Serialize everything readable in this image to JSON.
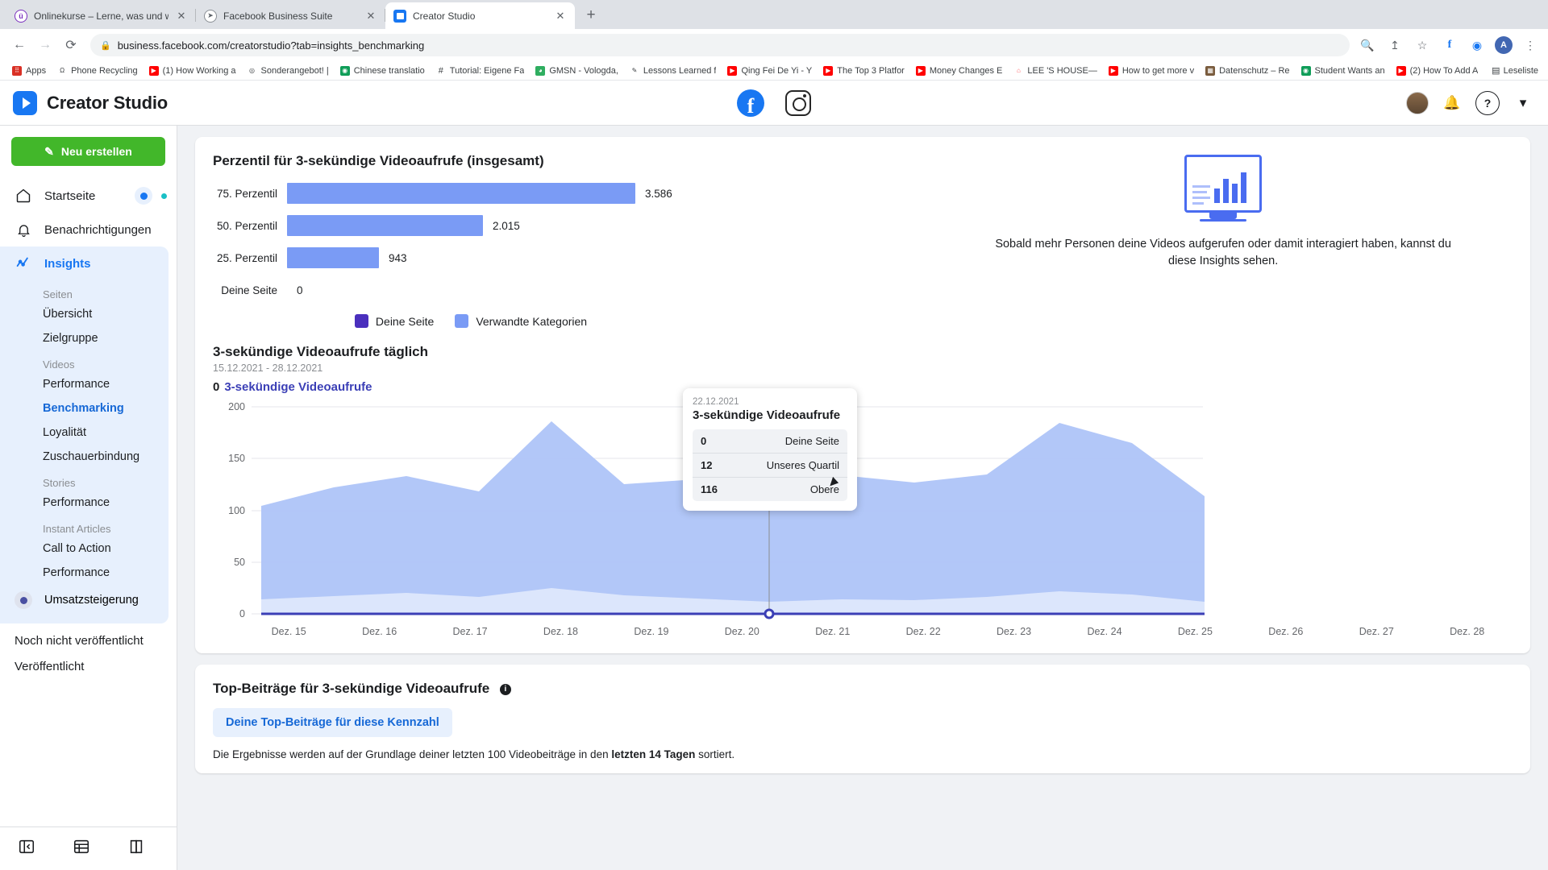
{
  "browser": {
    "tabs": [
      {
        "title": "Onlinekurse – Lerne, was und w",
        "icon": "udemy-icon",
        "active": false
      },
      {
        "title": "Facebook Business Suite",
        "icon": "compass-icon",
        "active": false
      },
      {
        "title": "Creator Studio",
        "icon": "creator-studio-icon",
        "active": true
      }
    ],
    "new_tab_label": "+",
    "close_label": "✕",
    "nav": {
      "back": "←",
      "forward": "→",
      "reload": "⟳"
    },
    "url": "business.facebook.com/creatorstudio?tab=insights_benchmarking",
    "lock_icon": "lock-icon",
    "toolbar_icons": [
      "zoom-icon",
      "share-icon",
      "star-icon",
      "facebook-ext-icon",
      "extension-icon",
      "menu-icon"
    ],
    "bookmarks": [
      {
        "label": "Apps",
        "icon": "apps-grid-icon",
        "color": "#d93025"
      },
      {
        "label": "Phone Recycling",
        "icon": "omega-icon",
        "color": "#5f6368"
      },
      {
        "label": "(1) How Working a",
        "icon": "youtube-icon",
        "color": "#ff0000"
      },
      {
        "label": "Sonderangebot! |",
        "icon": "circle-icon",
        "color": "#5f6368"
      },
      {
        "label": "Chinese translatio",
        "icon": "green-circle-icon",
        "color": "#0f9d58"
      },
      {
        "label": "Tutorial: Eigene Fa",
        "icon": "hash-icon",
        "color": "#3c4043"
      },
      {
        "label": "GMSN - Vologda,",
        "icon": "green-app-icon",
        "color": "#2fae60"
      },
      {
        "label": "Lessons Learned f",
        "icon": "pen-icon",
        "color": "#5f6368"
      },
      {
        "label": "Qing Fei De Yi - Y",
        "icon": "youtube-icon",
        "color": "#ff0000"
      },
      {
        "label": "The Top 3 Platfor",
        "icon": "youtube-icon",
        "color": "#ff0000"
      },
      {
        "label": "Money Changes E",
        "icon": "youtube-icon",
        "color": "#ff0000"
      },
      {
        "label": "LEE 'S HOUSE—",
        "icon": "airbnb-icon",
        "color": "#ff5a5f"
      },
      {
        "label": "How to get more v",
        "icon": "youtube-icon",
        "color": "#ff0000"
      },
      {
        "label": "Datenschutz – Re",
        "icon": "image-icon",
        "color": "#7a5c3e"
      },
      {
        "label": "Student Wants an",
        "icon": "green-circle-icon",
        "color": "#0f9d58"
      },
      {
        "label": "(2) How To Add A",
        "icon": "youtube-icon",
        "color": "#ff0000"
      }
    ],
    "reading_list": "Leseliste"
  },
  "appbar": {
    "brand": "Creator Studio",
    "brand_icon": "creator-studio-logo",
    "platform_tabs": [
      {
        "name": "facebook-tab",
        "glyph": "f"
      },
      {
        "name": "instagram-tab",
        "glyph": ""
      }
    ],
    "right_icons": [
      "avatar",
      "bell-icon",
      "help-icon",
      "chevron-down-icon"
    ],
    "help_glyph": "?",
    "chevron_glyph": "▾"
  },
  "sidebar": {
    "create_button": "Neu erstellen",
    "create_icon": "compose-icon",
    "items": [
      {
        "label": "Startseite",
        "icon": "home-icon",
        "badge": true
      },
      {
        "label": "Benachrichtigungen",
        "icon": "bell-icon",
        "badge": false
      }
    ],
    "insights": {
      "label": "Insights",
      "icon": "insights-chart-icon",
      "groups": [
        {
          "title": "Seiten",
          "links": [
            {
              "label": "Übersicht",
              "active": false
            },
            {
              "label": "Zielgruppe",
              "active": false
            }
          ]
        },
        {
          "title": "Videos",
          "links": [
            {
              "label": "Performance",
              "active": false
            },
            {
              "label": "Benchmarking",
              "active": true
            },
            {
              "label": "Loyalität",
              "active": false
            },
            {
              "label": "Zuschauerbindung",
              "active": false
            }
          ]
        },
        {
          "title": "Stories",
          "links": [
            {
              "label": "Performance",
              "active": false
            }
          ]
        },
        {
          "title": "Instant Articles",
          "links": [
            {
              "label": "Call to Action",
              "active": false
            },
            {
              "label": "Performance",
              "active": false
            }
          ]
        }
      ],
      "revenue": {
        "label": "Umsatzsteigerung",
        "icon": "revenue-dot-icon"
      }
    },
    "unpublished": "Noch nicht veröffentlicht",
    "published": "Veröffentlicht",
    "footer_icons": [
      "panel-toggle-icon",
      "grid-icon",
      "book-icon"
    ]
  },
  "percentile_card": {
    "title": "Perzentil für 3-sekündige Videoaufrufe (insgesamt)",
    "legend": [
      {
        "label": "Deine Seite",
        "color": "#4a2fbd"
      },
      {
        "label": "Verwandte Kategorien",
        "color": "#7a9bf5"
      }
    ],
    "illustration": {
      "name": "dashboard-monitor-illustration",
      "text": "Sobald mehr Personen deine Videos aufgerufen oder damit interagiert haben, kannst du diese Insights sehen."
    }
  },
  "daily_card": {
    "title": "3-sekündige Videoaufrufe täglich",
    "range": "15.12.2021 - 28.12.2021",
    "metric_value": "0",
    "metric_name": "3-sekündige Videoaufrufe",
    "tooltip": {
      "date": "22.12.2021",
      "title": "3-sekündige Videoaufrufe",
      "rows": [
        {
          "value": "0",
          "label": "Deine Seite"
        },
        {
          "value": "12",
          "label": "Unseres Quartil"
        },
        {
          "value": "116",
          "label": "Obere"
        }
      ]
    }
  },
  "top_posts_card": {
    "title": "Top-Beiträge für 3-sekündige Videoaufrufe",
    "info_icon": "info-icon",
    "button": "Deine Top-Beiträge für diese Kennzahl",
    "note_prefix": "Die Ergebnisse werden auf der Grundlage deiner letzten 100 Videobeiträge in den ",
    "note_bold": "letzten 14 Tagen",
    "note_suffix": " sortiert."
  },
  "chart_data": [
    {
      "type": "bar",
      "title": "Perzentil für 3-sekündige Videoaufrufe (insgesamt)",
      "orientation": "horizontal",
      "categories": [
        "75. Perzentil",
        "50. Perzentil",
        "25. Perzentil",
        "Deine Seite"
      ],
      "values": [
        3586,
        2015,
        943,
        0
      ],
      "value_labels": [
        "3.586",
        "2.015",
        "943",
        "0"
      ],
      "colors": [
        "#7a9bf5",
        "#7a9bf5",
        "#7a9bf5",
        "#4a2fbd"
      ],
      "xlabel": "",
      "ylabel": "",
      "grid": false,
      "legend": [
        "Deine Seite",
        "Verwandte Kategorien"
      ],
      "legend_position": "bottom"
    },
    {
      "type": "area",
      "title": "3-sekündige Videoaufrufe täglich",
      "subtitle": "15.12.2021 - 28.12.2021",
      "x": [
        "Dez. 15",
        "Dez. 16",
        "Dez. 17",
        "Dez. 18",
        "Dez. 19",
        "Dez. 20",
        "Dez. 21",
        "Dez. 22",
        "Dez. 23",
        "Dez. 24",
        "Dez. 25",
        "Dez. 26",
        "Dez. 27",
        "Dez. 28"
      ],
      "yticks": [
        0,
        50,
        100,
        150,
        200
      ],
      "ylim": [
        0,
        200
      ],
      "grid": true,
      "series": [
        {
          "name": "Obere",
          "color": "#aec4f8",
          "values": [
            104,
            122,
            133,
            118,
            186,
            126,
            131,
            116,
            134,
            127,
            135,
            184,
            165,
            114
          ]
        },
        {
          "name": "Unseres Quartil",
          "color": "#aec4f8",
          "values": [
            14,
            17,
            20,
            16,
            25,
            18,
            15,
            12,
            14,
            13,
            16,
            22,
            19,
            12
          ]
        },
        {
          "name": "Deine Seite",
          "color": "#3b3fb6",
          "values": [
            0,
            0,
            0,
            0,
            0,
            0,
            0,
            0,
            0,
            0,
            0,
            0,
            0,
            0
          ]
        }
      ],
      "highlight_index": 7,
      "highlight_label": "22.12.2021"
    }
  ]
}
